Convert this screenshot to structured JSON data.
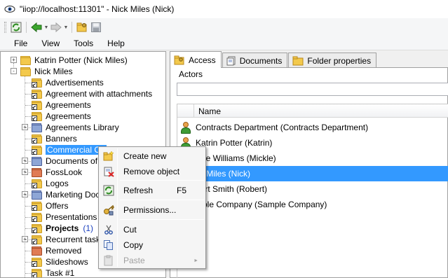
{
  "window": {
    "title": "\"iiop://localhost:11301\" - Nick Miles (Nick)"
  },
  "menubar": {
    "items": [
      "File",
      "View",
      "Tools",
      "Help"
    ]
  },
  "tree": {
    "items": [
      {
        "label": "Katrin Potter (Nick Miles)",
        "level": 0,
        "kind": "user-folder",
        "expander": "+"
      },
      {
        "label": "Nick Miles",
        "level": 0,
        "kind": "folder",
        "expander": "-"
      },
      {
        "label": "Advertisements",
        "level": 1,
        "kind": "shortcut"
      },
      {
        "label": "Agreement with attachments",
        "level": 1,
        "kind": "shortcut"
      },
      {
        "label": "Agreements",
        "level": 1,
        "kind": "shortcut"
      },
      {
        "label": "Agreements",
        "level": 1,
        "kind": "shortcut"
      },
      {
        "label": "Agreements Library",
        "level": 1,
        "kind": "library",
        "expander": "+"
      },
      {
        "label": "Banners",
        "level": 1,
        "kind": "shortcut"
      },
      {
        "label": "Commercial Off",
        "level": 1,
        "kind": "shortcut",
        "selected": true
      },
      {
        "label": "Documents of t",
        "level": 1,
        "kind": "library",
        "expander": "+"
      },
      {
        "label": "FossLook",
        "level": 1,
        "kind": "red",
        "expander": "+"
      },
      {
        "label": "Logos",
        "level": 1,
        "kind": "shortcut"
      },
      {
        "label": "Marketing Docu",
        "level": 1,
        "kind": "library",
        "expander": "+"
      },
      {
        "label": "Offers",
        "level": 1,
        "kind": "shortcut"
      },
      {
        "label": "Presentations",
        "level": 1,
        "kind": "shortcut"
      },
      {
        "label": "Projects",
        "level": 1,
        "kind": "shortcut",
        "bold": true,
        "count": "(1)"
      },
      {
        "label": "Recurrent tasks",
        "level": 1,
        "kind": "shortcut",
        "expander": "+"
      },
      {
        "label": "Removed",
        "level": 1,
        "kind": "red"
      },
      {
        "label": "Slideshows",
        "level": 1,
        "kind": "shortcut"
      },
      {
        "label": "Task #1",
        "level": 1,
        "kind": "shortcut"
      }
    ]
  },
  "tabs": [
    {
      "label": "Access",
      "active": true,
      "icon": "key-folder-icon"
    },
    {
      "label": "Documents",
      "active": false,
      "icon": "documents-icon"
    },
    {
      "label": "Folder properties",
      "active": false,
      "icon": "folder-icon"
    }
  ],
  "access": {
    "actors_label": "Actors",
    "actors_value": "",
    "column_name": "Name",
    "rows": [
      {
        "name": "Contracts Department (Contracts Department)",
        "selected": false
      },
      {
        "name": "Katrin Potter (Katrin)",
        "selected": false
      },
      {
        "name": "ckle Williams (Mickle)",
        "selected": false
      },
      {
        "name": "ck Miles (Nick)",
        "selected": true
      },
      {
        "name": "bert Smith (Robert)",
        "selected": false
      },
      {
        "name": "mple Company (Sample Company)",
        "selected": false
      }
    ]
  },
  "context_menu": {
    "items": [
      {
        "label": "Create new",
        "icon": "new-folder-icon",
        "shortcut": ""
      },
      {
        "label": "Remove object",
        "icon": "remove-icon",
        "shortcut": ""
      },
      {
        "label": "Refresh",
        "icon": "refresh-icon",
        "shortcut": "F5"
      },
      {
        "label": "Permissions...",
        "icon": "permissions-icon",
        "shortcut": ""
      },
      {
        "label": "Cut",
        "icon": "cut-icon",
        "shortcut": ""
      },
      {
        "label": "Copy",
        "icon": "copy-icon",
        "shortcut": ""
      },
      {
        "label": "Paste",
        "icon": "paste-icon",
        "shortcut": "",
        "disabled": true,
        "submenu": true
      }
    ]
  },
  "colors": {
    "selection": "#3399ff",
    "folder": "#f3c94c",
    "accent_green": "#3f9c35"
  }
}
